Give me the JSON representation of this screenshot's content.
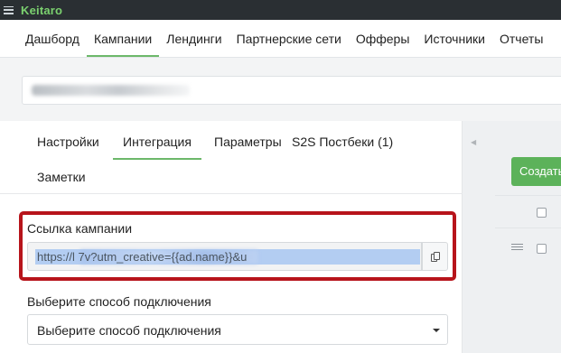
{
  "app": {
    "brand": "Keitaro"
  },
  "nav": {
    "items": [
      {
        "label": "Дашборд"
      },
      {
        "label": "Кампании",
        "active": true
      },
      {
        "label": "Лендинги"
      },
      {
        "label": "Партнерские сети"
      },
      {
        "label": "Офферы"
      },
      {
        "label": "Источники"
      },
      {
        "label": "Отчеты"
      }
    ]
  },
  "tabs": {
    "items": [
      {
        "label": "Настройки"
      },
      {
        "label": "Интеграция",
        "active": true
      },
      {
        "label": "Параметры"
      },
      {
        "label": "S2S Постбеки (1)"
      },
      {
        "label": "Заметки"
      }
    ]
  },
  "campaign_link": {
    "label": "Ссылка кампании",
    "value": "https://l                                    7v?utm_creative={{ad.name}}&u"
  },
  "connection": {
    "label": "Выберите способ подключения",
    "selected": "Выберите способ подключения"
  },
  "right_panel": {
    "create_label": "Создать"
  },
  "colors": {
    "brand": "#7bd16f",
    "accent": "#6cb86a",
    "highlight": "#b7141b",
    "create_button": "#5cb25a"
  },
  "icons": [
    "menu-icon",
    "copy-icon",
    "chevron-left-icon",
    "caret-down-icon",
    "drag-handle-icon"
  ]
}
